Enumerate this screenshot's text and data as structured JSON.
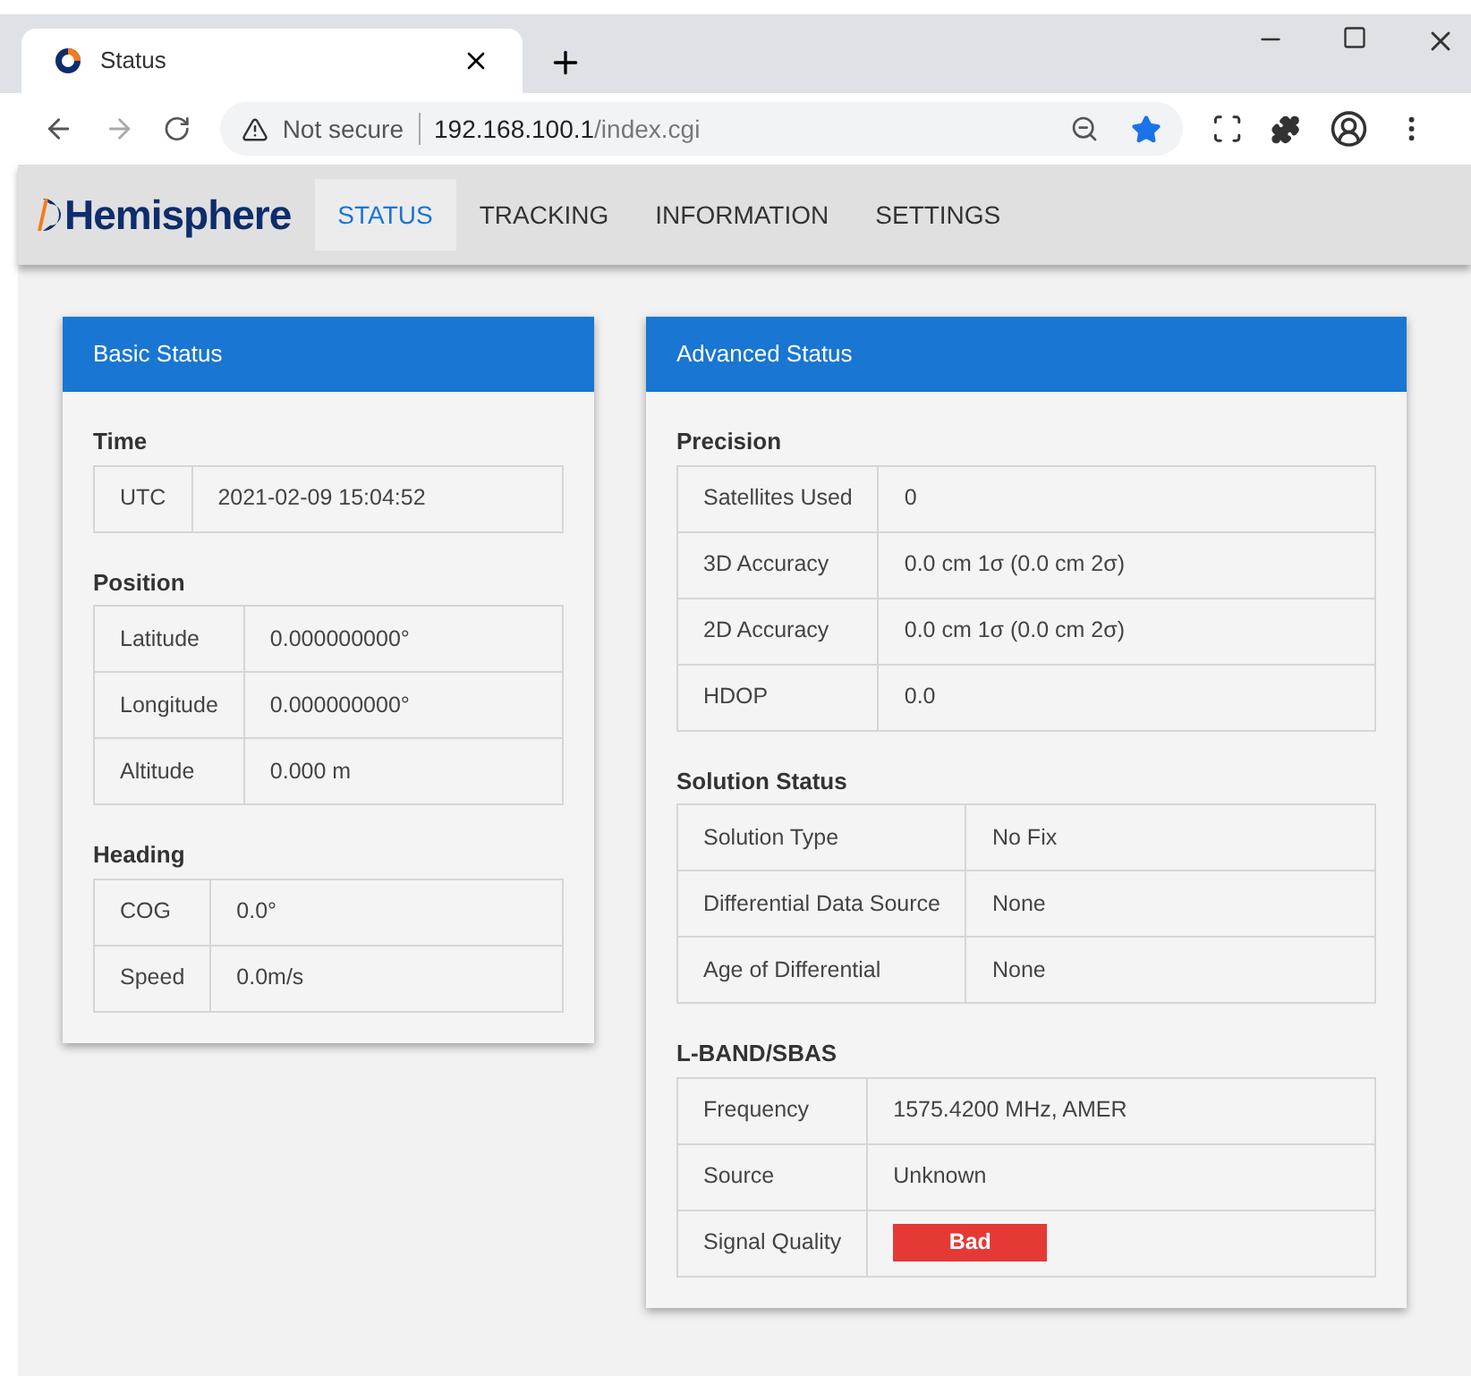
{
  "browser": {
    "tab_title": "Status",
    "security": "Not secure",
    "url_host": "192.168.100.1",
    "url_path": "/index.cgi"
  },
  "app": {
    "logo": "Hemisphere",
    "nav": [
      {
        "label": "STATUS",
        "selected": true
      },
      {
        "label": "TRACKING",
        "selected": false
      },
      {
        "label": "INFORMATION",
        "selected": false
      },
      {
        "label": "SETTINGS",
        "selected": false
      }
    ]
  },
  "cards": [
    {
      "title": "Basic Status",
      "sections": [
        {
          "title": "Time",
          "rows": [
            {
              "label": "UTC",
              "value": "2021-02-09 15:04:52",
              "kind": "text"
            }
          ]
        },
        {
          "title": "Position",
          "rows": [
            {
              "label": "Latitude",
              "value": "0.000000000°",
              "kind": "text"
            },
            {
              "label": "Longitude",
              "value": "0.000000000°",
              "kind": "text"
            },
            {
              "label": "Altitude",
              "value": "0.000 m",
              "kind": "text"
            }
          ]
        },
        {
          "title": "Heading",
          "rows": [
            {
              "label": "COG",
              "value": "0.0°",
              "kind": "text"
            },
            {
              "label": "Speed",
              "value": "0.0m/s",
              "kind": "text"
            }
          ]
        }
      ]
    },
    {
      "title": "Advanced Status",
      "sections": [
        {
          "title": "Precision",
          "rows": [
            {
              "label": "Satellites Used",
              "value": "0",
              "kind": "text"
            },
            {
              "label": "3D Accuracy",
              "value": "0.0 cm 1σ (0.0 cm 2σ)",
              "kind": "text"
            },
            {
              "label": "2D Accuracy",
              "value": "0.0 cm 1σ (0.0 cm 2σ)",
              "kind": "text"
            },
            {
              "label": "HDOP",
              "value": "0.0",
              "kind": "text"
            }
          ]
        },
        {
          "title": "Solution Status",
          "rows": [
            {
              "label": "Solution Type",
              "value": "No Fix",
              "kind": "text"
            },
            {
              "label": "Differential Data Source",
              "value": "None",
              "kind": "text"
            },
            {
              "label": "Age of Differential",
              "value": "None",
              "kind": "text"
            }
          ]
        },
        {
          "title": "L-BAND/SBAS",
          "rows": [
            {
              "label": "Frequency",
              "value": "1575.4200 MHz, AMER",
              "kind": "text"
            },
            {
              "label": "Source",
              "value": "Unknown",
              "kind": "text"
            },
            {
              "label": "Signal Quality",
              "value": "Bad",
              "kind": "badge",
              "color": "#e53935"
            }
          ]
        }
      ]
    }
  ]
}
